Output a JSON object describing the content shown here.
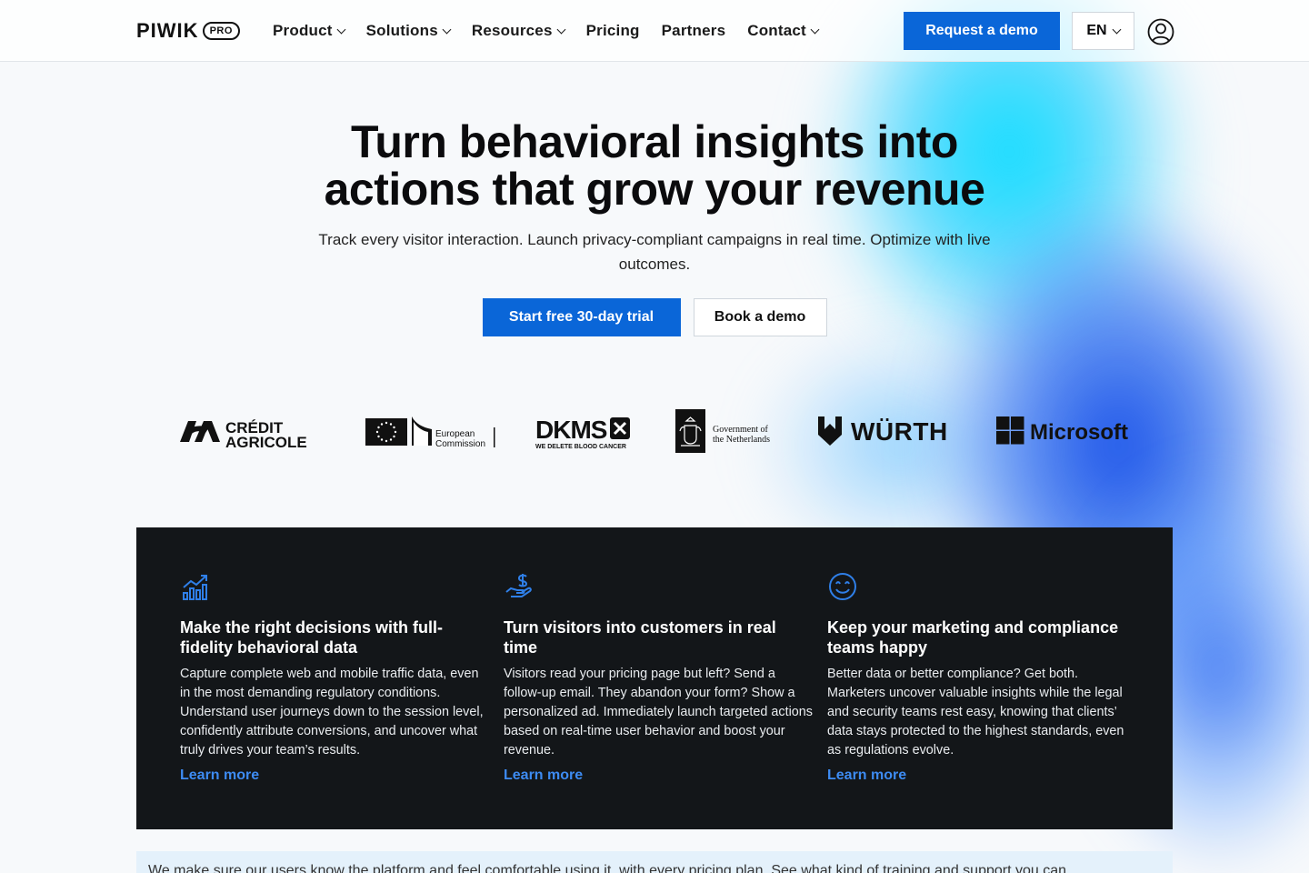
{
  "brand": {
    "name": "PIWIK",
    "badge": "PRO"
  },
  "nav": {
    "items": [
      {
        "label": "Product",
        "dropdown": true
      },
      {
        "label": "Solutions",
        "dropdown": true
      },
      {
        "label": "Resources",
        "dropdown": true
      },
      {
        "label": "Pricing",
        "dropdown": false
      },
      {
        "label": "Partners",
        "dropdown": false
      },
      {
        "label": "Contact",
        "dropdown": true
      }
    ],
    "cta": "Request a demo",
    "language": "EN",
    "user_icon": "user-icon"
  },
  "hero": {
    "title": "Turn behavioral insights into actions that grow your revenue",
    "subtitle": "Track every visitor interaction. Launch privacy-compliant campaigns in real time. Optimize with live outcomes.",
    "primary_cta": "Start free 30-day trial",
    "secondary_cta": "Book a demo"
  },
  "client_logos": {
    "credit_agricole": {
      "line1": "CRÉDIT",
      "line2": "AGRICOLE"
    },
    "european_commission": {
      "line1": "European",
      "line2": "Commission"
    },
    "dkms": {
      "name": "DKMS",
      "tagline": "WE DELETE BLOOD CANCER"
    },
    "netherlands": {
      "line1": "Government of",
      "line2": "the Netherlands"
    },
    "wurth": {
      "name": "WÜRTH"
    },
    "microsoft": {
      "name": "Microsoft"
    }
  },
  "features": [
    {
      "icon": "chart-growth-icon",
      "title": "Make the right decisions with full-fidelity behavioral data",
      "body": "Capture complete web and mobile traffic data, even in the most demanding regulatory conditions. Understand user journeys down to the session level, confidently attribute conversions, and uncover what truly drives your team’s results.",
      "link": "Learn more"
    },
    {
      "icon": "hand-dollar-icon",
      "title": "Turn visitors into customers in real time",
      "body": "Visitors read your pricing page but left? Send a follow-up email. They abandon your form? Show a personalized ad. Immediately launch targeted actions based on real-time user behavior and boost your revenue.",
      "link": "Learn more"
    },
    {
      "icon": "smiley-icon",
      "title": "Keep your marketing and compliance teams happy",
      "body": "Better data or better compliance? Get both. Marketers uncover valuable insights while the legal and security teams rest easy, knowing that clients’ data stays protected to the highest standards, even as regulations evolve.",
      "link": "Learn more"
    }
  ],
  "notice": {
    "text": "We make sure our users know the platform and feel comfortable using it, with every pricing plan. See what kind of training and support you can"
  },
  "colors": {
    "accent": "#0a66d8",
    "link": "#3d8bf2",
    "panel": "#131619",
    "notice_bg": "#e4f1fb"
  }
}
